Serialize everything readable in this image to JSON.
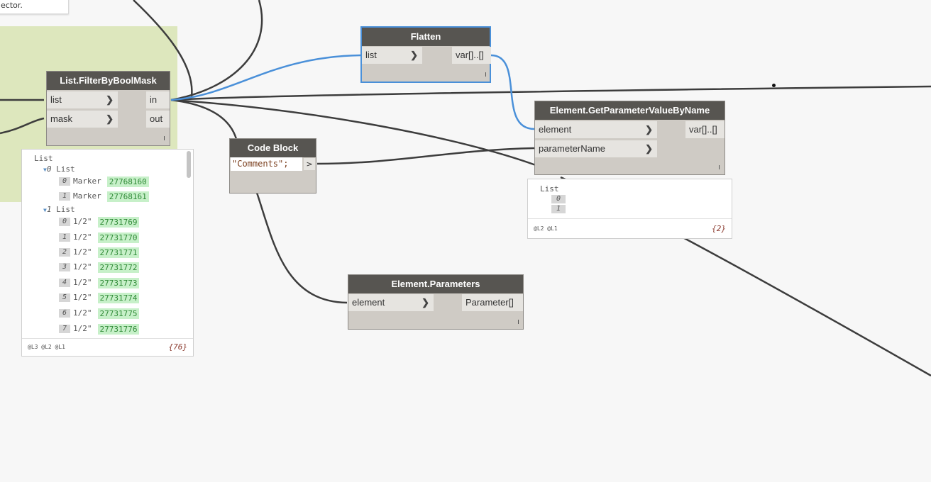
{
  "note": {
    "text": "ector."
  },
  "nodes": {
    "filter": {
      "title": "List.FilterByBoolMask",
      "in1": "list",
      "in2": "mask",
      "out1": "in",
      "out2": "out",
      "lacing": "l"
    },
    "flatten": {
      "title": "Flatten",
      "in1": "list",
      "out1": "var[]..[]",
      "lacing": "l"
    },
    "codeblock": {
      "title": "Code Block",
      "code": "\"Comments\";",
      "out": ">"
    },
    "getparam": {
      "title": "Element.GetParameterValueByName",
      "in1": "element",
      "in2": "parameterName",
      "out1": "var[]..[]",
      "lacing": "l"
    },
    "parameters": {
      "title": "Element.Parameters",
      "in1": "element",
      "out1": "Parameter[]",
      "lacing": "l"
    }
  },
  "previews": {
    "filter": {
      "root": "List",
      "groups": [
        {
          "index": "0",
          "label": "List",
          "items": [
            {
              "i": "0",
              "name": "Marker",
              "id": "27768160"
            },
            {
              "i": "1",
              "name": "Marker",
              "id": "27768161"
            }
          ]
        },
        {
          "index": "1",
          "label": "List",
          "items": [
            {
              "i": "0",
              "name": "1/2\"",
              "id": "27731769"
            },
            {
              "i": "1",
              "name": "1/2\"",
              "id": "27731770"
            },
            {
              "i": "2",
              "name": "1/2\"",
              "id": "27731771"
            },
            {
              "i": "3",
              "name": "1/2\"",
              "id": "27731772"
            },
            {
              "i": "4",
              "name": "1/2\"",
              "id": "27731773"
            },
            {
              "i": "5",
              "name": "1/2\"",
              "id": "27731774"
            },
            {
              "i": "6",
              "name": "1/2\"",
              "id": "27731775"
            },
            {
              "i": "7",
              "name": "1/2\"",
              "id": "27731776"
            }
          ]
        }
      ],
      "levels": "@L3 @L2 @L1",
      "count": "{76}"
    },
    "getparam": {
      "root": "List",
      "items": [
        "0",
        "1"
      ],
      "levels": "@L2 @L1",
      "count": "{2}"
    }
  },
  "colors": {
    "wire": "#3d3d3d",
    "wire_selected": "#4a90d9",
    "group": "#dde7bd",
    "node_header": "#575551",
    "node_body": "#cfcbc5"
  }
}
